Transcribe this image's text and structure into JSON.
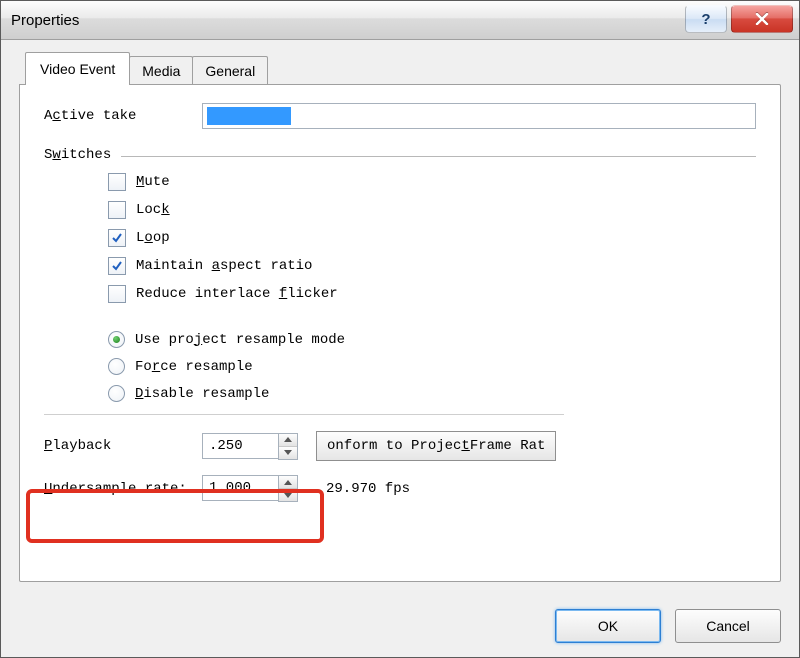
{
  "window": {
    "title": "Properties"
  },
  "tabs": [
    {
      "label": "Video Event",
      "active": true
    },
    {
      "label": "Media",
      "active": false
    },
    {
      "label": "General",
      "active": false
    }
  ],
  "active_take": {
    "label_pre": "A",
    "label_u": "c",
    "label_post": "tive take",
    "value": ""
  },
  "switches": {
    "legend_pre": "S",
    "legend_u": "w",
    "legend_post": "itches",
    "mute": {
      "pre": "",
      "u": "M",
      "post": "ute",
      "checked": false
    },
    "lock": {
      "pre": "Loc",
      "u": "k",
      "post": "",
      "checked": false
    },
    "loop": {
      "pre": "L",
      "u": "o",
      "post": "op",
      "checked": true
    },
    "aspect": {
      "pre": "Maintain ",
      "u": "a",
      "post": "spect ratio",
      "checked": true
    },
    "flicker": {
      "pre": "Reduce interlace ",
      "u": "f",
      "post": "licker",
      "checked": false
    }
  },
  "resample": {
    "project": {
      "pre": "Use pro",
      "u": "j",
      "post": "ect resample mode"
    },
    "force": {
      "pre": "Fo",
      "u": "r",
      "post": "ce resample"
    },
    "disable": {
      "pre": "",
      "u": "D",
      "post": "isable resample"
    },
    "selected": "project"
  },
  "playback": {
    "label_u": "P",
    "label_post": "layback",
    "value": ".250"
  },
  "conform_button": {
    "pre": "onform to Projec",
    "u": "t",
    "post": " Frame Rat"
  },
  "undersample": {
    "label_u": "U",
    "label_post": "ndersample rate:",
    "value": "1.000",
    "fps": "29.970 fps"
  },
  "buttons": {
    "ok": "OK",
    "cancel": "Cancel"
  }
}
